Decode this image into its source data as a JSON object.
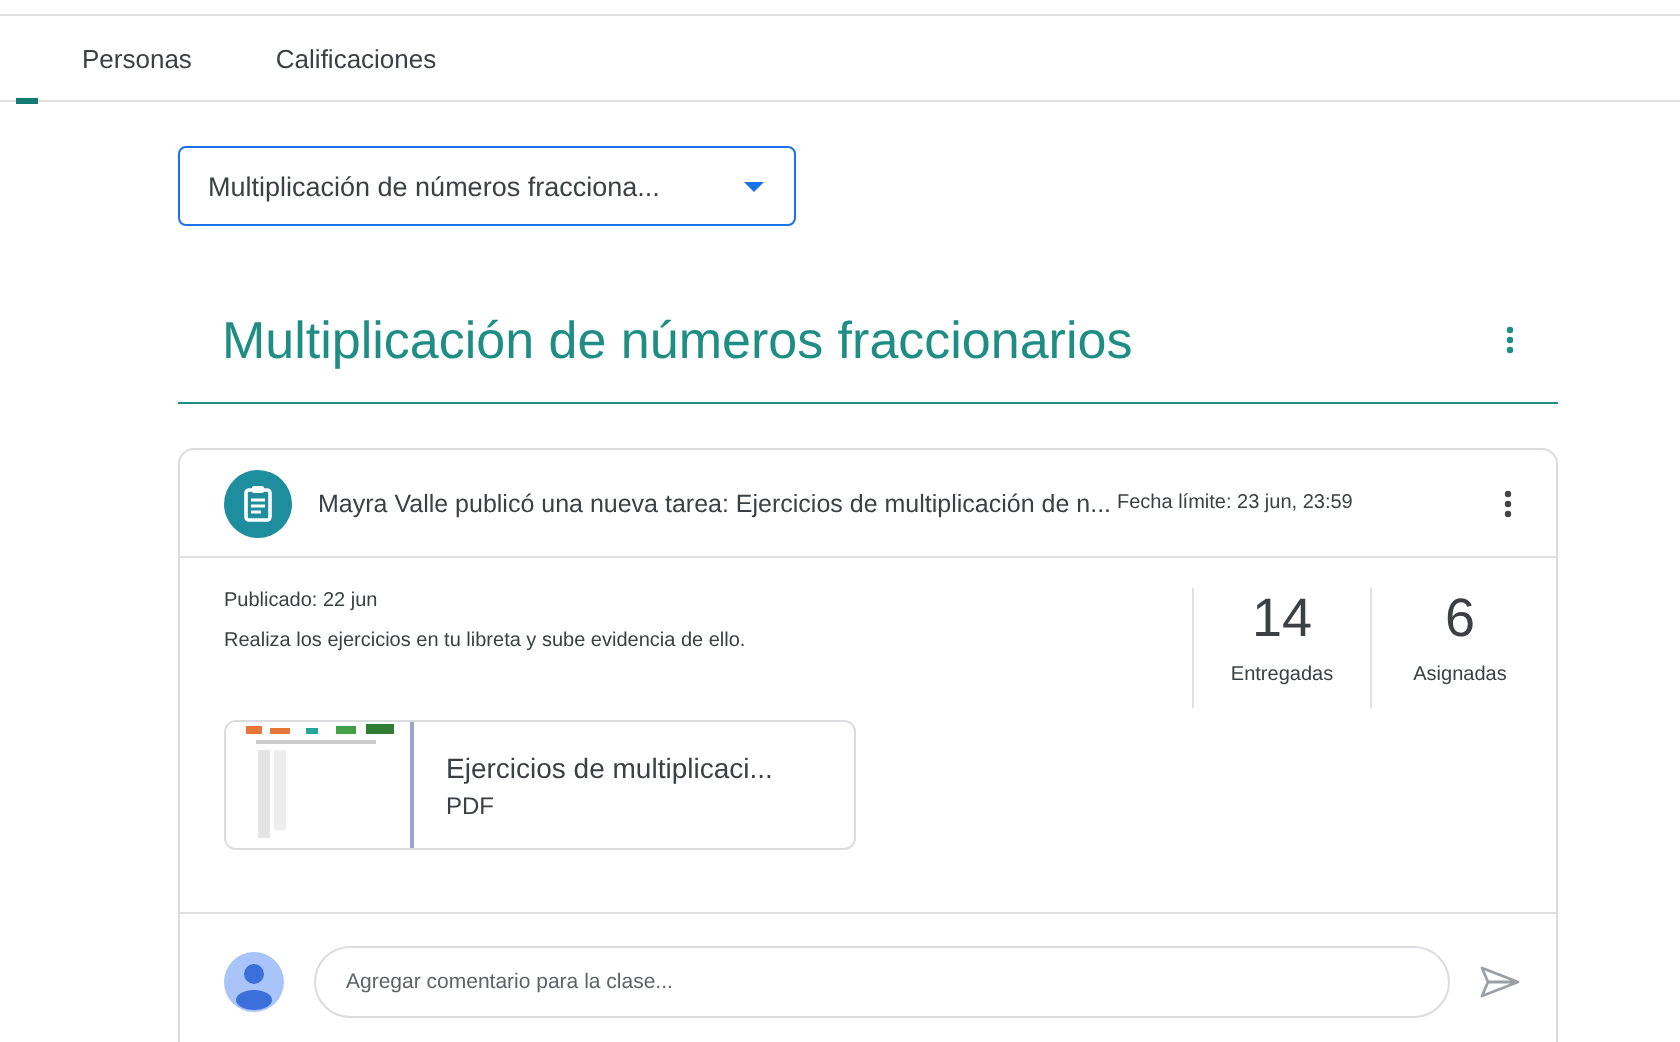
{
  "tabs": [
    {
      "label": "Personas",
      "selected": false
    },
    {
      "label": "Calificaciones",
      "selected": false
    }
  ],
  "topic_select": {
    "value": "Multiplicación de números fracciona..."
  },
  "topic": {
    "title": "Multiplicación de números fraccionarios"
  },
  "post": {
    "header": "Mayra Valle publicó una nueva tarea: Ejercicios de multiplicación de n...",
    "due": "Fecha límite: 23 jun, 23:59",
    "published": "Publicado: 22 jun",
    "description": "Realiza los ejercicios en tu libreta y sube evidencia de ello.",
    "stats": [
      {
        "count": "14",
        "label": "Entregadas"
      },
      {
        "count": "6",
        "label": "Asignadas"
      }
    ],
    "attachment": {
      "name": "Ejercicios de multiplicaci...",
      "type": "PDF"
    },
    "comment": {
      "placeholder": "Agregar comentario para la clase..."
    }
  }
}
